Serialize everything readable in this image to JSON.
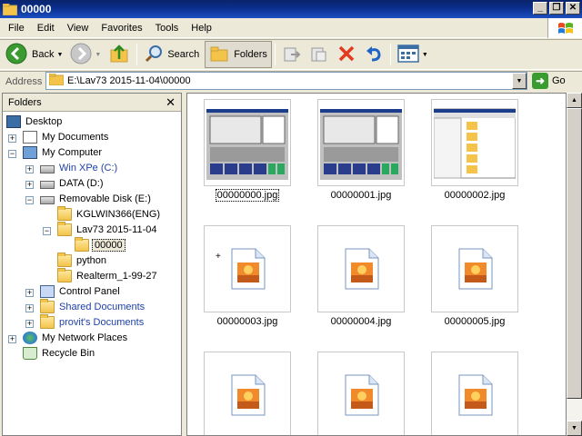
{
  "window": {
    "title": "00000"
  },
  "menu": [
    "File",
    "Edit",
    "View",
    "Favorites",
    "Tools",
    "Help"
  ],
  "toolbar": {
    "back_label": "Back",
    "search_label": "Search",
    "folders_label": "Folders"
  },
  "address": {
    "label": "Address",
    "value": "E:\\Lav73 2015-11-04\\00000",
    "go_label": "Go"
  },
  "folders_pane": {
    "title": "Folders",
    "tree": [
      {
        "label": "Desktop",
        "icon": "desktop-icon"
      },
      {
        "label": "My Documents",
        "icon": "documents-icon"
      },
      {
        "label": "My Computer",
        "icon": "computer-icon"
      },
      {
        "label": "Win XPe (C:)",
        "icon": "drive-icon"
      },
      {
        "label": "DATA (D:)",
        "icon": "drive-icon"
      },
      {
        "label": "Removable Disk (E:)",
        "icon": "drive-icon"
      },
      {
        "label": "KGLWIN366(ENG)",
        "icon": "folder-icon"
      },
      {
        "label": "Lav73 2015-11-04",
        "icon": "folder-icon"
      },
      {
        "label": "00000",
        "icon": "folder-open-icon"
      },
      {
        "label": "python",
        "icon": "folder-icon"
      },
      {
        "label": "Realterm_1-99-27",
        "icon": "folder-icon"
      },
      {
        "label": "Control Panel",
        "icon": "control-panel-icon"
      },
      {
        "label": "Shared Documents",
        "icon": "folder-icon"
      },
      {
        "label": "provit's Documents",
        "icon": "folder-icon"
      },
      {
        "label": "My Network Places",
        "icon": "network-icon"
      },
      {
        "label": "Recycle Bin",
        "icon": "recycle-bin-icon"
      }
    ]
  },
  "files": [
    {
      "name": "00000000.jpg",
      "thumb": "screenshot"
    },
    {
      "name": "00000001.jpg",
      "thumb": "screenshot"
    },
    {
      "name": "00000002.jpg",
      "thumb": "explorer"
    },
    {
      "name": "00000003.jpg",
      "thumb": "image-icon"
    },
    {
      "name": "00000004.jpg",
      "thumb": "image-icon"
    },
    {
      "name": "00000005.jpg",
      "thumb": "image-icon"
    },
    {
      "name": "",
      "thumb": "image-icon"
    },
    {
      "name": "",
      "thumb": "image-icon"
    },
    {
      "name": "",
      "thumb": "image-icon"
    }
  ],
  "colors": {
    "titlebar": "#0a246a",
    "selection": "#ece9d8",
    "link_blue": "#1e3fa8"
  }
}
